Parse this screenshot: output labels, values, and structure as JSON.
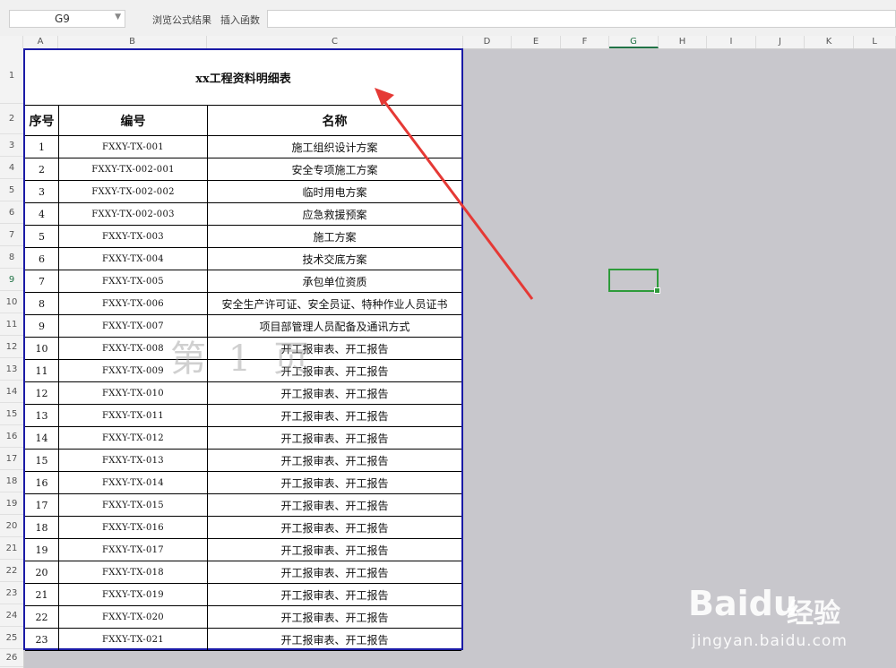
{
  "toolbar": {
    "cell_ref": "G9",
    "browse_formula_label": "浏览公式结果",
    "insert_function_label": "插入函数"
  },
  "columns": [
    "A",
    "B",
    "C",
    "D",
    "E",
    "F",
    "G",
    "H",
    "I",
    "J",
    "K",
    "L"
  ],
  "selected_column": "G",
  "selected_row": "9",
  "row_numbers": [
    "1",
    "2",
    "3",
    "4",
    "5",
    "6",
    "7",
    "8",
    "9",
    "10",
    "11",
    "12",
    "13",
    "14",
    "15",
    "16",
    "17",
    "18",
    "19",
    "20",
    "21",
    "22",
    "23",
    "24",
    "25",
    "26"
  ],
  "table": {
    "title": "xx工程资料明细表",
    "headers": [
      "序号",
      "编号",
      "名称"
    ],
    "rows": [
      [
        "1",
        "FXXY-TX-001",
        "施工组织设计方案"
      ],
      [
        "2",
        "FXXY-TX-002-001",
        "安全专项施工方案"
      ],
      [
        "3",
        "FXXY-TX-002-002",
        "临时用电方案"
      ],
      [
        "4",
        "FXXY-TX-002-003",
        "应急救援预案"
      ],
      [
        "5",
        "FXXY-TX-003",
        "施工方案"
      ],
      [
        "6",
        "FXXY-TX-004",
        "技术交底方案"
      ],
      [
        "7",
        "FXXY-TX-005",
        "承包单位资质"
      ],
      [
        "8",
        "FXXY-TX-006",
        "安全生产许可证、安全员证、特种作业人员证书"
      ],
      [
        "9",
        "FXXY-TX-007",
        "项目部管理人员配备及通讯方式"
      ],
      [
        "10",
        "FXXY-TX-008",
        "开工报审表、开工报告"
      ],
      [
        "11",
        "FXXY-TX-009",
        "开工报审表、开工报告"
      ],
      [
        "12",
        "FXXY-TX-010",
        "开工报审表、开工报告"
      ],
      [
        "13",
        "FXXY-TX-011",
        "开工报审表、开工报告"
      ],
      [
        "14",
        "FXXY-TX-012",
        "开工报审表、开工报告"
      ],
      [
        "15",
        "FXXY-TX-013",
        "开工报审表、开工报告"
      ],
      [
        "16",
        "FXXY-TX-014",
        "开工报审表、开工报告"
      ],
      [
        "17",
        "FXXY-TX-015",
        "开工报审表、开工报告"
      ],
      [
        "18",
        "FXXY-TX-016",
        "开工报审表、开工报告"
      ],
      [
        "19",
        "FXXY-TX-017",
        "开工报审表、开工报告"
      ],
      [
        "20",
        "FXXY-TX-018",
        "开工报审表、开工报告"
      ],
      [
        "21",
        "FXXY-TX-019",
        "开工报审表、开工报告"
      ],
      [
        "22",
        "FXXY-TX-020",
        "开工报审表、开工报告"
      ],
      [
        "23",
        "FXXY-TX-021",
        "开工报审表、开工报告"
      ]
    ]
  },
  "page_watermark": "第 1 页",
  "logo": {
    "brand": "Baidu",
    "product": "经验",
    "site": "jingyan.baidu.com"
  },
  "colors": {
    "selection": "#2e9b3a",
    "print_area_border": "#1a1aa6",
    "arrow": "#e53935",
    "canvas_gray": "#c8c7cc"
  }
}
